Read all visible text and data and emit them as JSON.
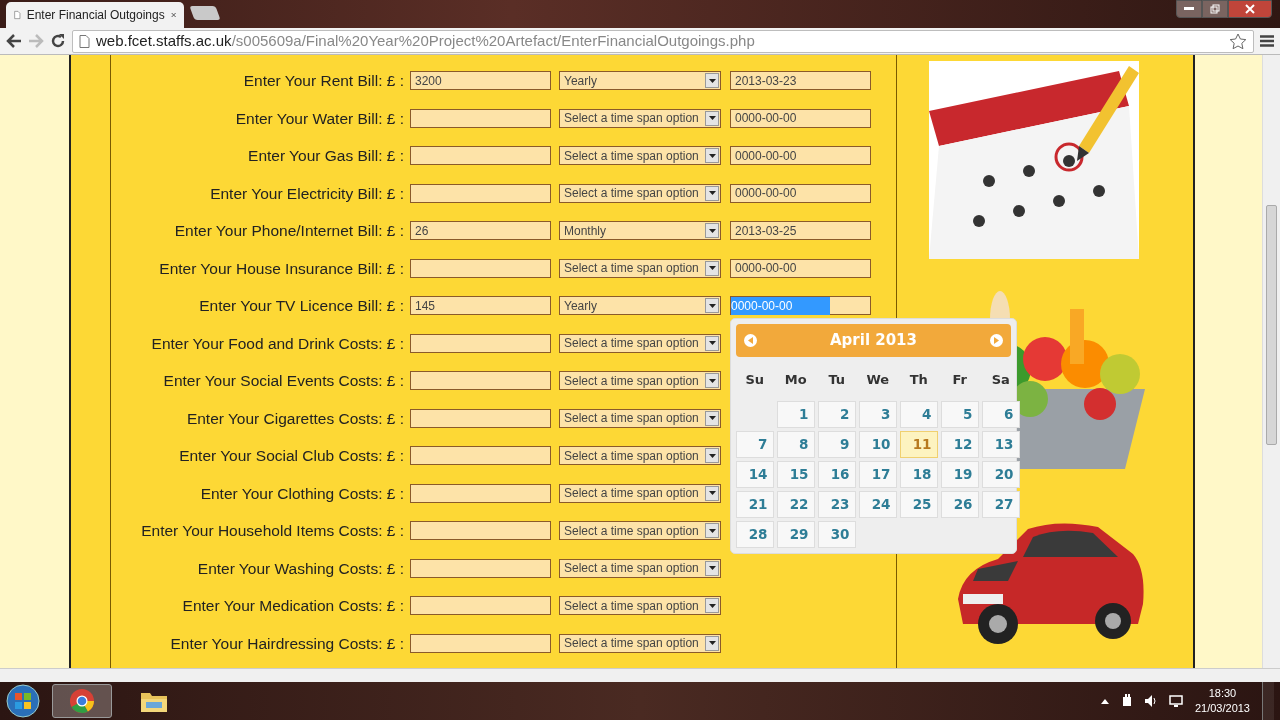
{
  "browser": {
    "tab_title": "Enter Financial Outgoings",
    "url_host": "web.fcet.staffs.ac.uk",
    "url_path": "/s005609a/Final%20Year%20Project%20Artefact/EnterFinancialOutgoings.php"
  },
  "rows": [
    {
      "label": "Enter Your Rent Bill: £ :",
      "amount": "3200",
      "timespan": "Yearly",
      "date": "2013-03-23",
      "date_selected": false
    },
    {
      "label": "Enter Your Water Bill: £ :",
      "timespan": "Select a time span option",
      "date": "0000-00-00",
      "date_selected": false
    },
    {
      "label": "Enter Your Gas Bill: £ :",
      "timespan": "Select a time span option",
      "date": "0000-00-00",
      "date_selected": false
    },
    {
      "label": "Enter Your Electricity Bill: £ :",
      "timespan": "Select a time span option",
      "date": "0000-00-00",
      "date_selected": false
    },
    {
      "label": "Enter Your Phone/Internet Bill: £ :",
      "amount": "26",
      "timespan": "Monthly",
      "date": "2013-03-25",
      "date_selected": false
    },
    {
      "label": "Enter Your House Insurance Bill: £ :",
      "timespan": "Select a time span option",
      "date": "0000-00-00",
      "date_selected": false
    },
    {
      "label": "Enter Your TV Licence Bill: £ :",
      "amount": "145",
      "timespan": "Yearly",
      "date": "0000-00-00",
      "date_selected": true
    },
    {
      "label": "Enter Your Food and Drink Costs: £ :",
      "timespan": "Select a time span option"
    },
    {
      "label": "Enter Your Social Events Costs: £ :",
      "timespan": "Select a time span option"
    },
    {
      "label": "Enter Your Cigarettes Costs: £ :",
      "timespan": "Select a time span option"
    },
    {
      "label": "Enter Your Social Club Costs: £ :",
      "timespan": "Select a time span option"
    },
    {
      "label": "Enter Your Clothing Costs: £ :",
      "timespan": "Select a time span option"
    },
    {
      "label": "Enter Your Household Items Costs: £ :",
      "timespan": "Select a time span option"
    },
    {
      "label": "Enter Your Washing Costs: £ :",
      "timespan": "Select a time span option"
    },
    {
      "label": "Enter Your Medication Costs: £ :",
      "timespan": "Select a time span option"
    },
    {
      "label": "Enter Your Hairdressing Costs: £ :",
      "timespan": "Select a time span option"
    }
  ],
  "pictures": [
    {
      "kind": "calendar"
    },
    {
      "kind": "food"
    },
    {
      "kind": "car"
    }
  ],
  "datepicker": {
    "title": "April 2013",
    "weekdays": [
      "Su",
      "Mo",
      "Tu",
      "We",
      "Th",
      "Fr",
      "Sa"
    ],
    "cells": [
      {
        "kind": "blank"
      },
      {
        "kind": "day",
        "label": "1",
        "highlighted": false
      },
      {
        "kind": "day",
        "label": "2",
        "highlighted": false
      },
      {
        "kind": "day",
        "label": "3",
        "highlighted": false
      },
      {
        "kind": "day",
        "label": "4",
        "highlighted": false
      },
      {
        "kind": "day",
        "label": "5",
        "highlighted": false
      },
      {
        "kind": "day",
        "label": "6",
        "highlighted": false
      },
      {
        "kind": "day",
        "label": "7",
        "highlighted": false
      },
      {
        "kind": "day",
        "label": "8",
        "highlighted": false
      },
      {
        "kind": "day",
        "label": "9",
        "highlighted": false
      },
      {
        "kind": "day",
        "label": "10",
        "highlighted": false
      },
      {
        "kind": "day",
        "label": "11",
        "highlighted": true
      },
      {
        "kind": "day",
        "label": "12",
        "highlighted": false
      },
      {
        "kind": "day",
        "label": "13",
        "highlighted": false
      },
      {
        "kind": "day",
        "label": "14",
        "highlighted": false
      },
      {
        "kind": "day",
        "label": "15",
        "highlighted": false
      },
      {
        "kind": "day",
        "label": "16",
        "highlighted": false
      },
      {
        "kind": "day",
        "label": "17",
        "highlighted": false
      },
      {
        "kind": "day",
        "label": "18",
        "highlighted": false
      },
      {
        "kind": "day",
        "label": "19",
        "highlighted": false
      },
      {
        "kind": "day",
        "label": "20",
        "highlighted": false
      },
      {
        "kind": "day",
        "label": "21",
        "highlighted": false
      },
      {
        "kind": "day",
        "label": "22",
        "highlighted": false
      },
      {
        "kind": "day",
        "label": "23",
        "highlighted": false
      },
      {
        "kind": "day",
        "label": "24",
        "highlighted": false
      },
      {
        "kind": "day",
        "label": "25",
        "highlighted": false
      },
      {
        "kind": "day",
        "label": "26",
        "highlighted": false
      },
      {
        "kind": "day",
        "label": "27",
        "highlighted": false
      },
      {
        "kind": "day",
        "label": "28",
        "highlighted": false
      },
      {
        "kind": "day",
        "label": "29",
        "highlighted": false
      },
      {
        "kind": "day",
        "label": "30",
        "highlighted": false
      }
    ]
  },
  "taskbar": {
    "time": "18:30",
    "date": "21/03/2013"
  }
}
